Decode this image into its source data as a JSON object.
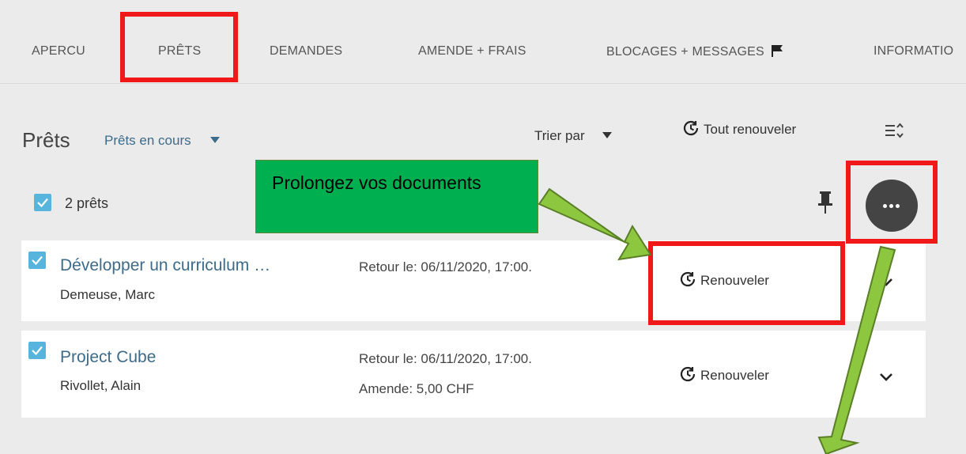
{
  "tabs": [
    {
      "label": "APERCU"
    },
    {
      "label": "PRÊTS"
    },
    {
      "label": "DEMANDES"
    },
    {
      "label": "AMENDE + FRAIS"
    },
    {
      "label": "BLOCAGES + MESSAGES"
    },
    {
      "label": "INFORMATIO"
    }
  ],
  "loans_section": {
    "title": "Prêts",
    "filter_value": "Prêts en cours",
    "sort_label": "Trier par",
    "renew_all_label": "Tout renouveler",
    "count_label": "2 prêts"
  },
  "loans": [
    {
      "title": "Développer un curriculum …",
      "author": "Demeuse, Marc",
      "due": "Retour le: 06/11/2020, 17:00.",
      "fine": "",
      "renew_label": "Renouveler"
    },
    {
      "title": "Project Cube",
      "author": "Rivollet, Alain",
      "due": "Retour le: 06/11/2020, 17:00.",
      "fine": "Amende: 5,00 CHF",
      "renew_label": "Renouveler"
    }
  ],
  "annotation": {
    "callout_text": "Prolongez vos documents"
  },
  "colors": {
    "highlight": "#f01818",
    "callout_bg": "#00b050",
    "arrow": "#8dc63f",
    "link": "#3d6b8a",
    "checkbox": "#57b5dd"
  },
  "icons": [
    "flag-icon",
    "chevron-down-icon",
    "clock-renew-icon",
    "density-toggle-icon",
    "pin-icon",
    "more-options-icon",
    "checkbox-icon"
  ]
}
